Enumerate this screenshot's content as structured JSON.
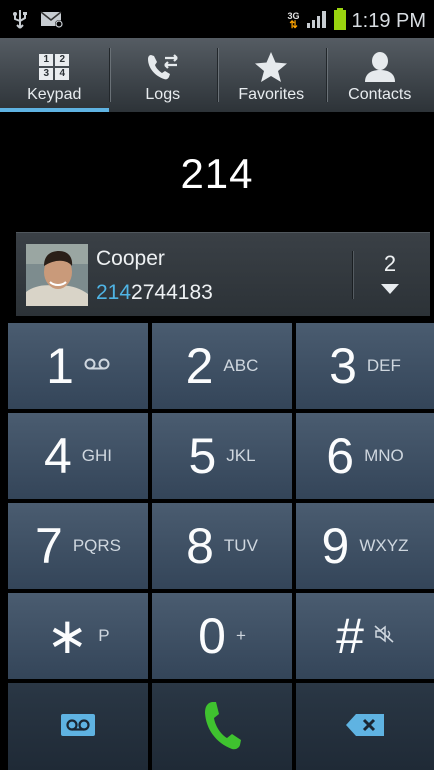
{
  "status_bar": {
    "network": "3G",
    "time": "1:19 PM"
  },
  "tabs": [
    {
      "label": "Keypad",
      "icon": "keypad-icon",
      "active": true
    },
    {
      "label": "Logs",
      "icon": "logs-icon",
      "active": false
    },
    {
      "label": "Favorites",
      "icon": "star-icon",
      "active": false
    },
    {
      "label": "Contacts",
      "icon": "person-icon",
      "active": false
    }
  ],
  "keypad_icon_digits": [
    "1",
    "2",
    "3",
    "4"
  ],
  "dialed_number": "214",
  "suggestion": {
    "name": "Cooper",
    "number_match": "214",
    "number_rest": "2744183",
    "count": "2"
  },
  "keys": [
    {
      "digit": "1",
      "sub": ""
    },
    {
      "digit": "2",
      "sub": "ABC"
    },
    {
      "digit": "3",
      "sub": "DEF"
    },
    {
      "digit": "4",
      "sub": "GHI"
    },
    {
      "digit": "5",
      "sub": "JKL"
    },
    {
      "digit": "6",
      "sub": "MNO"
    },
    {
      "digit": "7",
      "sub": "PQRS"
    },
    {
      "digit": "8",
      "sub": "TUV"
    },
    {
      "digit": "9",
      "sub": "WXYZ"
    },
    {
      "digit": "∗",
      "sub": "P"
    },
    {
      "digit": "0",
      "sub": "+"
    },
    {
      "digit": "#",
      "sub": ""
    }
  ],
  "colors": {
    "accent": "#5fb3e2",
    "call_green": "#3fc22f",
    "key_bg": "#3e5064"
  }
}
